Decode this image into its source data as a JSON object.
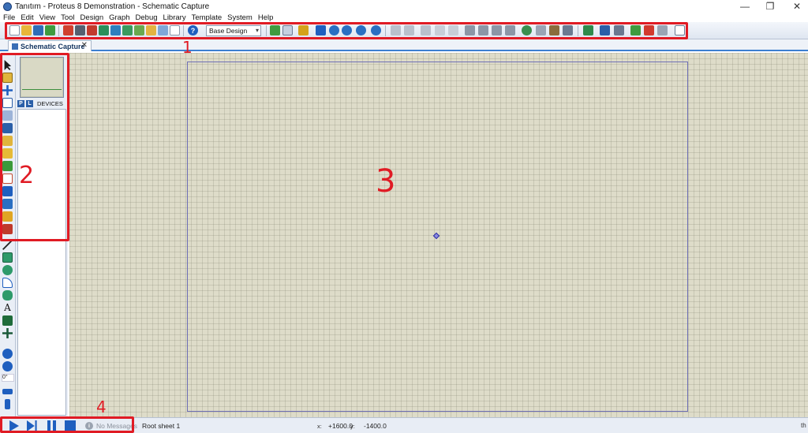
{
  "window": {
    "title": "Tanıtım - Proteus 8 Demonstration - Schematic Capture",
    "controls": [
      "—",
      "❐",
      "✕"
    ]
  },
  "menu": [
    "File",
    "Edit",
    "View",
    "Tool",
    "Design",
    "Graph",
    "Debug",
    "Library",
    "Template",
    "System",
    "Help"
  ],
  "toolbar": {
    "design_select": "Base Design",
    "help_glyph": "?"
  },
  "tabs": [
    {
      "label": "Schematic Capture",
      "close": "✕"
    }
  ],
  "panel": {
    "p_button": "P",
    "l_button": "L",
    "devices_label": "DEVICES",
    "angle_value": "0°"
  },
  "status": {
    "message_icon": "i",
    "message": "No Messages",
    "sheet": "Root sheet 1",
    "x_label": "x:",
    "x_value": "+1600.0",
    "y_label": "y:",
    "y_value": "-1400.0",
    "units": "th"
  },
  "annotations": [
    "1",
    "2",
    "3",
    "4"
  ],
  "colors": {
    "annotation_red": "#e01b24",
    "canvas_bg": "#dedcc9",
    "sheet_border": "#6e6fb5",
    "accent_blue": "#1f5fbf"
  }
}
